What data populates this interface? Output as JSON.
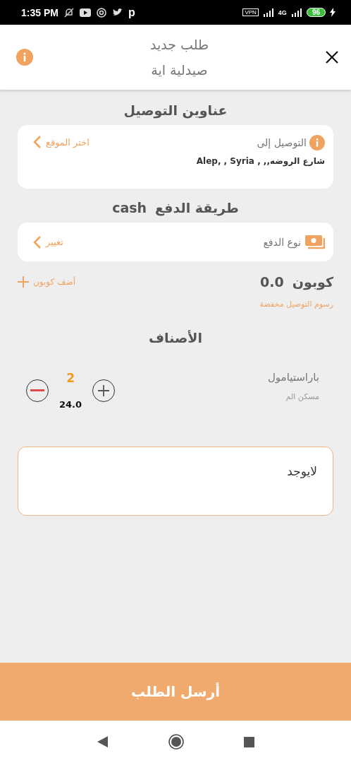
{
  "status_bar": {
    "time": "1:35 PM",
    "app_glyph": "p",
    "network_label": "4G",
    "battery": "96",
    "vpn": "VPN"
  },
  "header": {
    "title": "طلب جديد",
    "subtitle": "صيدلية اية"
  },
  "delivery": {
    "heading": "عناوين التوصيل",
    "label": "التوصيل إلى",
    "address": "شارع الروضه,, , Alep, , Syria",
    "action": "اختر الموقع"
  },
  "payment": {
    "heading": "طريقة الدفع",
    "method": "cash",
    "label": "نوع الدفع",
    "action": "تغيير"
  },
  "coupon": {
    "label": "كوبون",
    "value": "0.0",
    "action": "أضف كوبون",
    "note": "رسوم التوصيل مخفضة"
  },
  "items": {
    "heading": "الأصناف",
    "rows": [
      {
        "name": "باراستيامول",
        "description": "مسكن الم",
        "quantity": "2",
        "price": "24.0"
      }
    ]
  },
  "notes": {
    "value": "لايوجد"
  },
  "submit": {
    "label": "أرسل الطلب"
  }
}
